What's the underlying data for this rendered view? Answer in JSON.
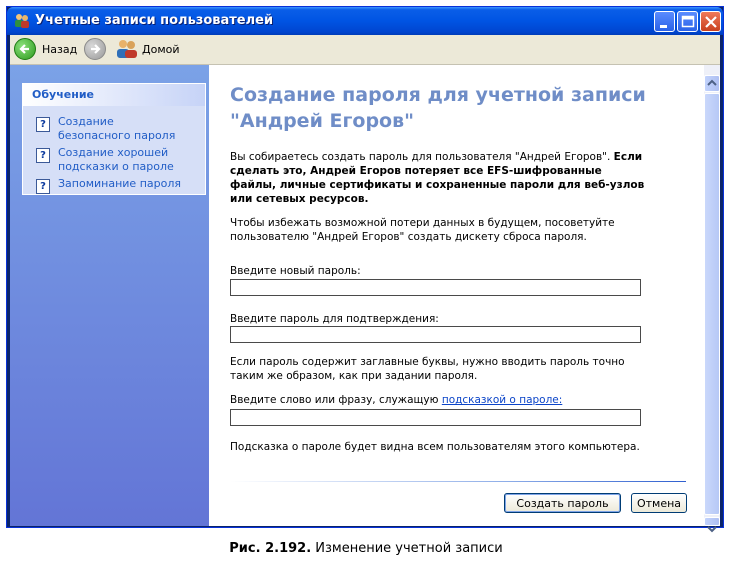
{
  "window": {
    "title": "Учетные записи пользователей"
  },
  "toolbar": {
    "back_label": "Назад",
    "home_label": "Домой"
  },
  "side_panel": {
    "header": "Обучение",
    "items": [
      {
        "label": "Создание безопасного пароля",
        "icon": "help-icon"
      },
      {
        "label": "Создание хорошей подсказки о пароле",
        "icon": "help-icon"
      },
      {
        "label": "Запоминание пароля",
        "icon": "help-icon"
      }
    ]
  },
  "main": {
    "title": "Создание пароля для учетной записи \"Андрей Егоров\"",
    "warning_normal": "Вы собираетесь создать пароль для пользователя \"Андрей Егоров\". ",
    "warning_bold": "Если сделать это, Андрей Егоров потеряет все EFS-шифрованные файлы, личные сертификаты и сохраненные пароли для веб-узлов или сетевых ресурсов.",
    "advice": "Чтобы избежать возможной потери данных в будущем, посоветуйте пользователю \"Андрей Егоров\" создать дискету сброса пароля.",
    "new_password_label": "Введите новый пароль:",
    "new_password_value": "",
    "confirm_password_label": "Введите пароль для подтверждения:",
    "confirm_password_value": "",
    "case_note": "Если пароль содержит заглавные буквы, нужно вводить пароль точно таким же образом, как при задании пароля.",
    "hint_label_prefix": "Введите слово или фразу, служащую ",
    "hint_link": "подсказкой о пароле:",
    "hint_value": "",
    "hint_note": "Подсказка о пароле будет видна всем пользователям этого компьютера.",
    "create_button": "Создать пароль",
    "cancel_button": "Отмена"
  },
  "caption": {
    "figure": "Рис. 2.192.",
    "text": " Изменение учетной записи"
  },
  "colors": {
    "titlebar": "#0054e3",
    "side_panel": "#7ba2e7",
    "title_text": "#6f8dc7",
    "link": "#215dc6"
  }
}
